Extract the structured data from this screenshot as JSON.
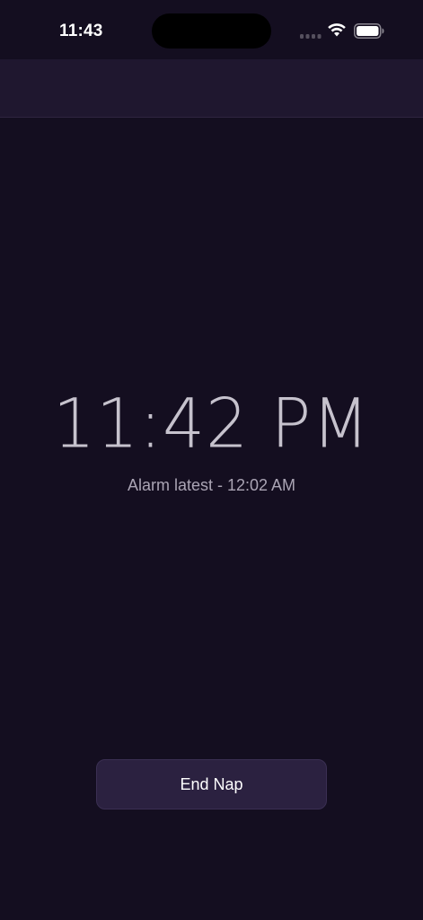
{
  "status_bar": {
    "time": "11:43",
    "icons": [
      "signal-icon",
      "wifi-icon",
      "battery-icon"
    ]
  },
  "colors": {
    "background": "#140e20",
    "header": "#1f172f",
    "button": "#2b2140",
    "clock_text": "#d6d2dc",
    "secondary_text": "#aaa4b4"
  },
  "main": {
    "current_time": "11:42 PM",
    "alarm_label": "Alarm latest - 12:02 AM"
  },
  "actions": {
    "end_nap_label": "End Nap"
  }
}
